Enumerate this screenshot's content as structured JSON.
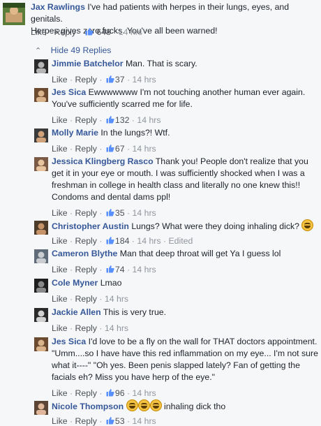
{
  "top_comment": {
    "author": "Jax Rawlings",
    "text_line1": "I've had patients with herpes in their lungs, eyes, and genitals.",
    "text_line2": "Herpes gives zero fucks. You've all been warned!",
    "like": "Like",
    "reply": "Reply",
    "likes": "648",
    "time": "14 hrs"
  },
  "hide_replies": "Hide 49 Replies",
  "replies": [
    {
      "author": "Jimmie Batchelor",
      "lines": [
        "Man. That is scary."
      ],
      "likes": "37",
      "time": "14 hrs"
    },
    {
      "author": "Jes Sica",
      "lines": [
        "Ewwwwwww I'm not touching another human ever again.",
        "You've sufficiently scarred me for life."
      ],
      "likes": "132",
      "time": "14 hrs"
    },
    {
      "author": "Molly Marie",
      "lines": [
        "In the lungs?! Wtf."
      ],
      "likes": "67",
      "time": "14 hrs"
    },
    {
      "author": "Jessica Klingberg Rasco",
      "lines": [
        "Thank you! People don't realize that you",
        "get it in your eye or mouth. I was sufficiently shocked when I was a",
        "freshman in college in health class and literally no one knew this!!",
        "Condoms and dental dams ppl!"
      ],
      "likes": "35",
      "time": "14 hrs"
    },
    {
      "author": "Christopher Austin",
      "lines": [
        "Lungs? What were they doing inhaling dick?"
      ],
      "likes": "184",
      "time": "14 hrs",
      "edited": "Edited"
    },
    {
      "author": "Cameron Blythe",
      "lines": [
        "Man that deep throat will get Ya I guess lol"
      ],
      "likes": "74",
      "time": "14 hrs"
    },
    {
      "author": "Cole Myner",
      "lines": [
        "Lmao"
      ],
      "likes": "",
      "time": "14 hrs"
    },
    {
      "author": "Jackie Allen",
      "lines": [
        "This is very true."
      ],
      "likes": "",
      "time": "14 hrs"
    },
    {
      "author": "Jes Sica",
      "lines": [
        "I'd love to be a fly on the wall for THAT doctors appointment.",
        "\"Umm....so I have have this red inflammation on my eye... I'm not sure",
        "what it----\" \"Oh yes. Been penis slapped lately? Fan of getting the",
        "facials eh? Miss you have herp of the eye.\""
      ],
      "likes": "96",
      "time": "14 hrs"
    },
    {
      "author": "Nicole Thompson",
      "lines": [
        "inhaling dick tho"
      ],
      "likes": "53",
      "time": "14 hrs"
    }
  ],
  "labels": {
    "like": "Like",
    "reply": "Reply"
  },
  "colors": {
    "name": "#365899",
    "meta": "#90949c",
    "background": "#f6f7f9"
  }
}
